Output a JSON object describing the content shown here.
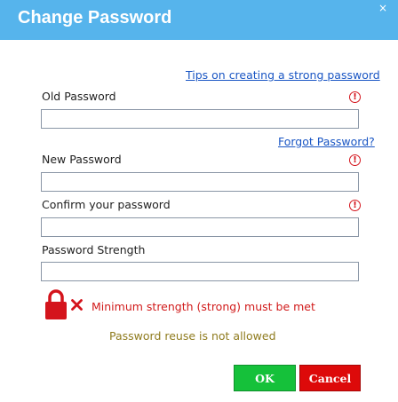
{
  "dialog": {
    "title": "Change Password",
    "close_glyph": "×"
  },
  "links": {
    "tips": "Tips on creating a strong password",
    "forgot": "Forgot Password?"
  },
  "fields": {
    "old_password": {
      "label": "Old Password",
      "value": ""
    },
    "new_password": {
      "label": "New Password",
      "value": ""
    },
    "confirm_password": {
      "label": "Confirm your password",
      "value": ""
    },
    "strength": {
      "label": "Password Strength",
      "value": ""
    }
  },
  "validation": {
    "required_glyph": "!",
    "strength_message": "Minimum strength (strong) must be met",
    "reuse_message": "Password reuse is not allowed"
  },
  "buttons": {
    "ok": "OK",
    "cancel": "Cancel"
  },
  "icons": {
    "close": "close-icon",
    "required": "exclamation-circle-icon",
    "lock": "lock-icon",
    "error": "x-icon"
  },
  "colors": {
    "header": "#56b4ec",
    "link": "#1a56c4",
    "error": "#d4141c",
    "reuse_text": "#8f7b1e",
    "ok_button": "#15c13a",
    "cancel_button": "#dd0a0a"
  }
}
